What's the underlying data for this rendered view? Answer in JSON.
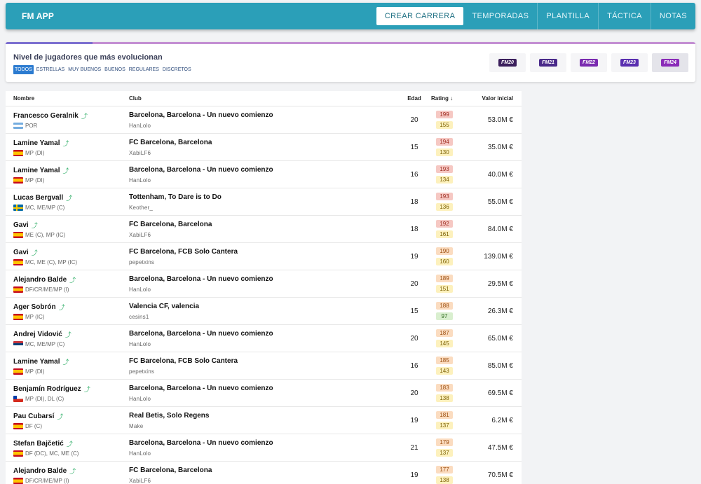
{
  "app": {
    "title": "FM APP",
    "nav": [
      {
        "label": "CREAR CARRERA",
        "active": true
      },
      {
        "label": "TEMPORADAS",
        "active": false
      },
      {
        "label": "PLANTILLA",
        "active": false
      },
      {
        "label": "TÁCTICA",
        "active": false
      },
      {
        "label": "NOTAS",
        "active": false
      }
    ]
  },
  "filter_card": {
    "title": "Nivel de jugadores que más evolucionan",
    "filters": [
      {
        "label": "TODOS",
        "active": true
      },
      {
        "label": "ESTRELLAS",
        "active": false
      },
      {
        "label": "MUY BUENOS",
        "active": false
      },
      {
        "label": "BUENOS",
        "active": false
      },
      {
        "label": "REGULARES",
        "active": false
      },
      {
        "label": "DISCRETOS",
        "active": false
      }
    ],
    "versions": [
      {
        "label": "FM20",
        "color": "#3b1f5c",
        "active": false
      },
      {
        "label": "FM21",
        "color": "#4a2a8a",
        "active": false
      },
      {
        "label": "FM22",
        "color": "#7a2bb0",
        "active": false
      },
      {
        "label": "FM23",
        "color": "#5a2fb0",
        "active": false
      },
      {
        "label": "FM24",
        "color": "#8a2bb8",
        "active": true
      }
    ]
  },
  "table": {
    "columns": {
      "name": "Nombre",
      "club": "Club",
      "age": "Edad",
      "rating": "Rating ↓",
      "value": "Valor inicial"
    },
    "rows": [
      {
        "name": "Francesco Geralnik",
        "flag": "ar",
        "pos": "POR",
        "club": "Barcelona, Barcelona - Un nuevo comienzo",
        "user": "HanLolo",
        "age": "20",
        "r1": "199",
        "r1c": "red",
        "r2": "155",
        "r2c": "yellow",
        "value": "53.0M €"
      },
      {
        "name": "Lamine Yamal",
        "flag": "es",
        "pos": "MP (DI)",
        "club": "FC Barcelona, Barcelona",
        "user": "XabiLF6",
        "age": "15",
        "r1": "194",
        "r1c": "red",
        "r2": "130",
        "r2c": "yellow",
        "value": "35.0M €"
      },
      {
        "name": "Lamine Yamal",
        "flag": "es",
        "pos": "MP (DI)",
        "club": "Barcelona, Barcelona - Un nuevo comienzo",
        "user": "HanLolo",
        "age": "16",
        "r1": "193",
        "r1c": "red",
        "r2": "134",
        "r2c": "yellow",
        "value": "40.0M €"
      },
      {
        "name": "Lucas Bergvall",
        "flag": "se",
        "pos": "MC, ME/MP (C)",
        "club": "Tottenham, To Dare is to Do",
        "user": "Keother_",
        "age": "18",
        "r1": "193",
        "r1c": "red",
        "r2": "136",
        "r2c": "yellow",
        "value": "55.0M €"
      },
      {
        "name": "Gavi",
        "flag": "es",
        "pos": "ME (C), MP (IC)",
        "club": "FC Barcelona, Barcelona",
        "user": "XabiLF6",
        "age": "18",
        "r1": "192",
        "r1c": "red",
        "r2": "161",
        "r2c": "yellow",
        "value": "84.0M €"
      },
      {
        "name": "Gavi",
        "flag": "es",
        "pos": "MC, ME (C), MP (IC)",
        "club": "FC Barcelona, FCB Solo Cantera",
        "user": "pepetxins",
        "age": "19",
        "r1": "190",
        "r1c": "orange",
        "r2": "160",
        "r2c": "yellow",
        "value": "139.0M €"
      },
      {
        "name": "Alejandro Balde",
        "flag": "es",
        "pos": "DF/CR/ME/MP (I)",
        "club": "Barcelona, Barcelona - Un nuevo comienzo",
        "user": "HanLolo",
        "age": "20",
        "r1": "189",
        "r1c": "orange",
        "r2": "151",
        "r2c": "yellow",
        "value": "29.5M €"
      },
      {
        "name": "Ager Sobrón",
        "flag": "es",
        "pos": "MP (IC)",
        "club": "Valencia CF, valencia",
        "user": "cesins1",
        "age": "15",
        "r1": "188",
        "r1c": "orange",
        "r2": "97",
        "r2c": "green",
        "value": "26.3M €"
      },
      {
        "name": "Andrej Vidović",
        "flag": "rs",
        "pos": "MC, ME/MP (C)",
        "club": "Barcelona, Barcelona - Un nuevo comienzo",
        "user": "HanLolo",
        "age": "20",
        "r1": "187",
        "r1c": "orange",
        "r2": "145",
        "r2c": "yellow",
        "value": "65.0M €"
      },
      {
        "name": "Lamine Yamal",
        "flag": "es",
        "pos": "MP (DI)",
        "club": "FC Barcelona, FCB Solo Cantera",
        "user": "pepetxins",
        "age": "16",
        "r1": "185",
        "r1c": "orange",
        "r2": "143",
        "r2c": "yellow",
        "value": "85.0M €"
      },
      {
        "name": "Benjamín Rodríguez",
        "flag": "cl",
        "pos": "MP (DI), DL (C)",
        "club": "Barcelona, Barcelona - Un nuevo comienzo",
        "user": "HanLolo",
        "age": "20",
        "r1": "183",
        "r1c": "orange",
        "r2": "138",
        "r2c": "yellow",
        "value": "69.5M €"
      },
      {
        "name": "Pau Cubarsí",
        "flag": "es",
        "pos": "DF (C)",
        "club": "Real Betis, Solo Regens",
        "user": "Make",
        "age": "19",
        "r1": "181",
        "r1c": "orange",
        "r2": "137",
        "r2c": "yellow",
        "value": "6.2M €"
      },
      {
        "name": "Stefan Bajčetić",
        "flag": "es",
        "pos": "DF (DC), MC, ME (C)",
        "club": "Barcelona, Barcelona - Un nuevo comienzo",
        "user": "HanLolo",
        "age": "21",
        "r1": "179",
        "r1c": "orange",
        "r2": "137",
        "r2c": "yellow",
        "value": "47.5M €"
      },
      {
        "name": "Alejandro Balde",
        "flag": "es",
        "pos": "DF/CR/ME/MP (I)",
        "club": "FC Barcelona, Barcelona",
        "user": "XabiLF6",
        "age": "19",
        "r1": "177",
        "r1c": "orange",
        "r2": "138",
        "r2c": "yellow",
        "value": "70.5M €"
      }
    ]
  },
  "icons": {
    "trend": "trending-up-icon"
  }
}
